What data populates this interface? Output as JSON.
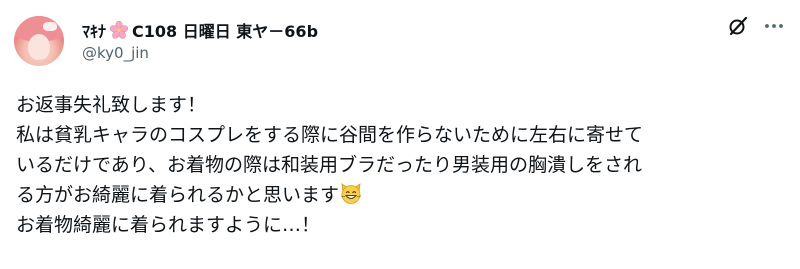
{
  "author": {
    "display_name_prefix": "ﾏｷﾅ",
    "display_name_icon": "cherry-blossom-icon",
    "display_name_suffix": "C108 日曜日 東ヤ－66b",
    "handle": "@ky0_jin",
    "avatar": "avatar-image"
  },
  "actions": {
    "grok_icon": "grok-icon",
    "more_icon": "more-icon"
  },
  "post": {
    "lines": [
      "お返事失礼致します！",
      "私は貧乳キャラのコスプレをする際に谷間を作らないために左右に寄せて",
      "いるだけであり、お着物の際は和装用ブラだったり男装用の胸潰しをされ",
      "る方がお綺麗に着られるかと思います",
      "お着物綺麗に着られますように…！"
    ],
    "line4_emoji": "grinning-cat-icon"
  },
  "colors": {
    "text": "#0f1419",
    "secondary": "#536471",
    "background": "#ffffff"
  }
}
